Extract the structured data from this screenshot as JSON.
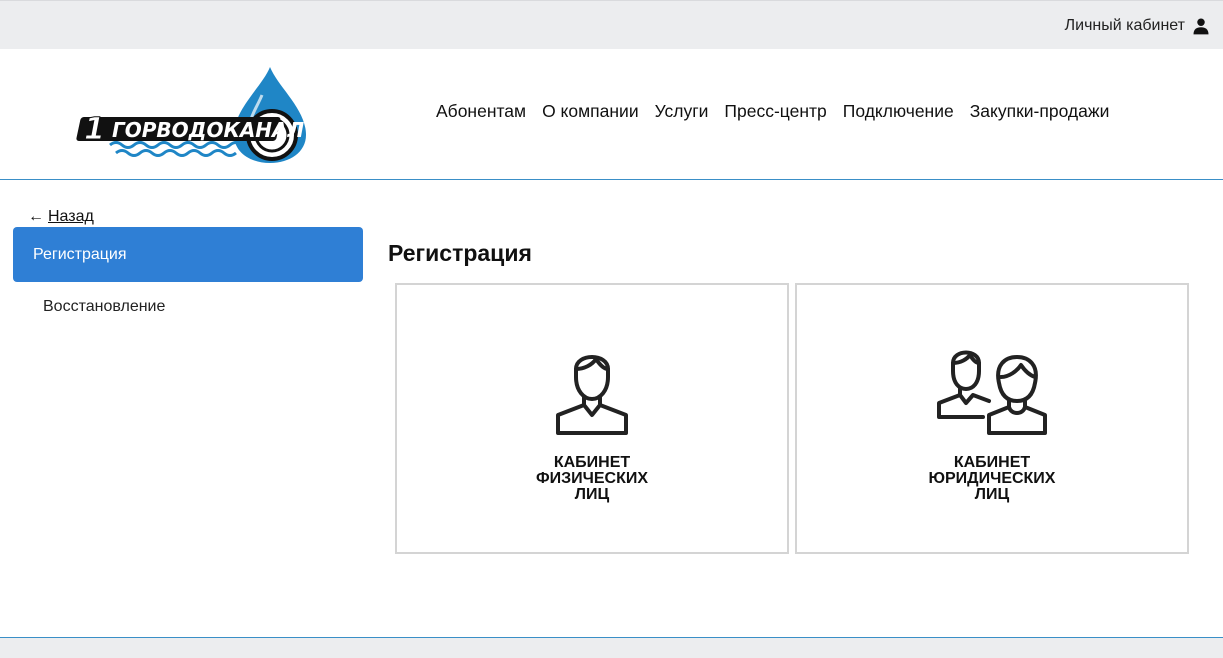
{
  "topbar": {
    "account_label": "Личный кабинет",
    "account_icon": "user-icon"
  },
  "header": {
    "logo_text": "ГОРВОДОКАНАЛ",
    "logo_number": "1",
    "nav": [
      "Абонентам",
      "О компании",
      "Услуги",
      "Пресс-центр",
      "Подключение",
      "Закупки-продажи"
    ]
  },
  "sidebar": {
    "back_arrow": "←",
    "back_label": "Назад",
    "items": [
      "Регистрация",
      "Восстановление"
    ]
  },
  "main": {
    "title": "Регистрация",
    "cards": [
      {
        "icon": "person-icon",
        "lines": [
          "КАБИНЕТ",
          "ФИЗИЧЕСКИХ",
          "ЛИЦ"
        ]
      },
      {
        "icon": "people-icon",
        "lines": [
          "КАБИНЕТ",
          "ЮРИДИЧЕСКИХ",
          "ЛИЦ"
        ]
      }
    ]
  },
  "colors": {
    "accent": "#2f7fd5",
    "line": "#3a8fc7",
    "topbar_bg": "#ecedef"
  }
}
